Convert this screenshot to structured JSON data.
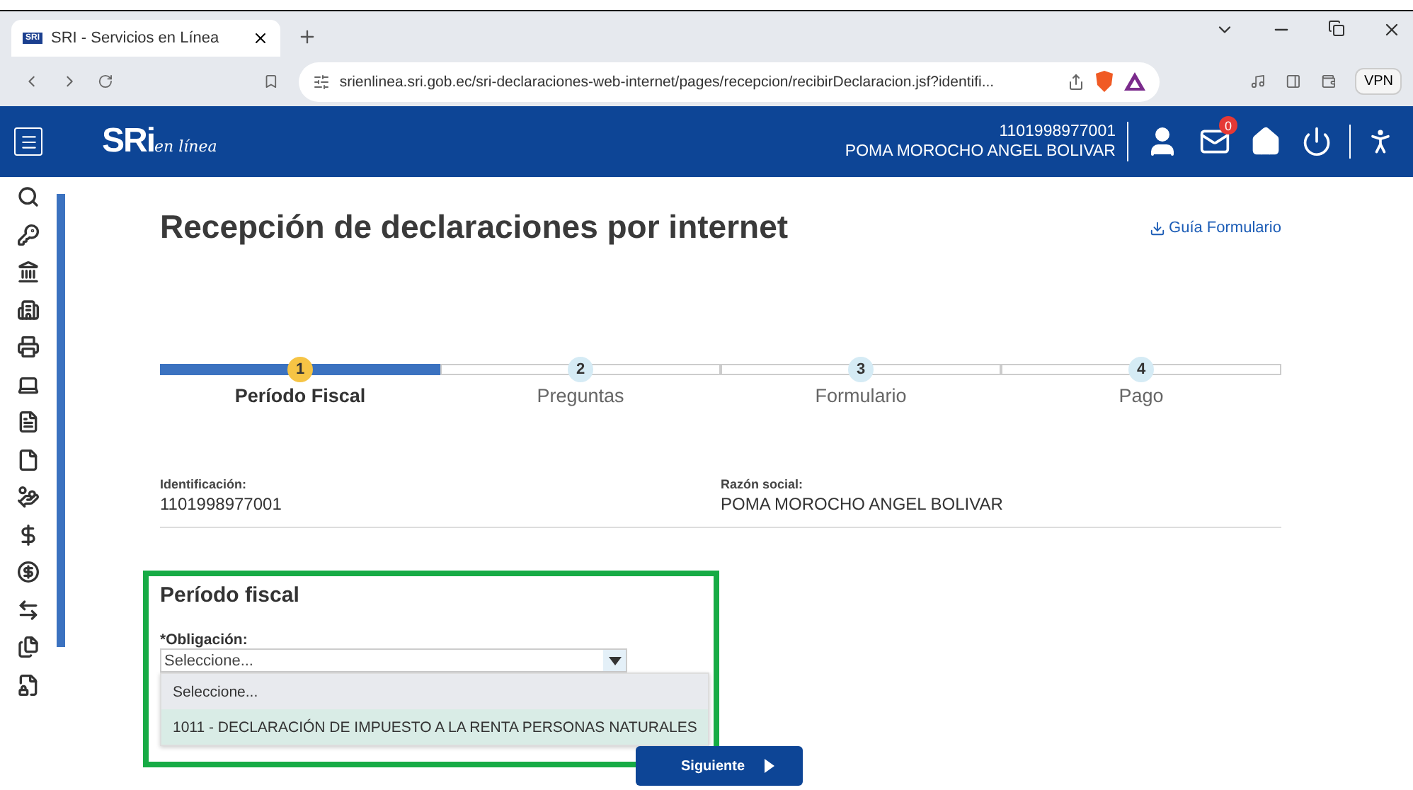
{
  "browser": {
    "tab_title": "SRI - Servicios en Línea",
    "tab_badge": "SRI",
    "url": "srienlinea.sri.gob.ec/sri-declaraciones-web-internet/pages/recepcion/recibirDeclaracion.jsf?identifi...",
    "vpn": "VPN"
  },
  "header": {
    "logo": "SRi",
    "logo_tagline": "en línea",
    "ruc": "1101998977001",
    "name": "POMA MOROCHO ANGEL BOLIVAR",
    "notifications": "0"
  },
  "page": {
    "title": "Recepción de declaraciones por internet",
    "guide_link": "Guía Formulario"
  },
  "steps": [
    {
      "number": "1",
      "label": "Período Fiscal",
      "selected": true
    },
    {
      "number": "2",
      "label": "Preguntas",
      "selected": false
    },
    {
      "number": "3",
      "label": "Formulario",
      "selected": false
    },
    {
      "number": "4",
      "label": "Pago",
      "selected": false
    }
  ],
  "fields": [
    {
      "label": "Identificación:",
      "value": "1101998977001"
    },
    {
      "label": "Razón social:",
      "value": "POMA MOROCHO ANGEL BOLIVAR"
    }
  ],
  "section": {
    "title": "Período fiscal",
    "select_label": "*Obligación:",
    "select_value": "Seleccione...",
    "expanded": true,
    "options": [
      {
        "label": "Seleccione...",
        "selected": false
      },
      {
        "label": "1011 - DECLARACIÓN DE IMPUESTO A LA RENTA PERSONAS NATURALES",
        "selected": true
      }
    ]
  },
  "button": {
    "label": "Siguiente"
  },
  "annotation": {
    "color": "#17ab45"
  }
}
